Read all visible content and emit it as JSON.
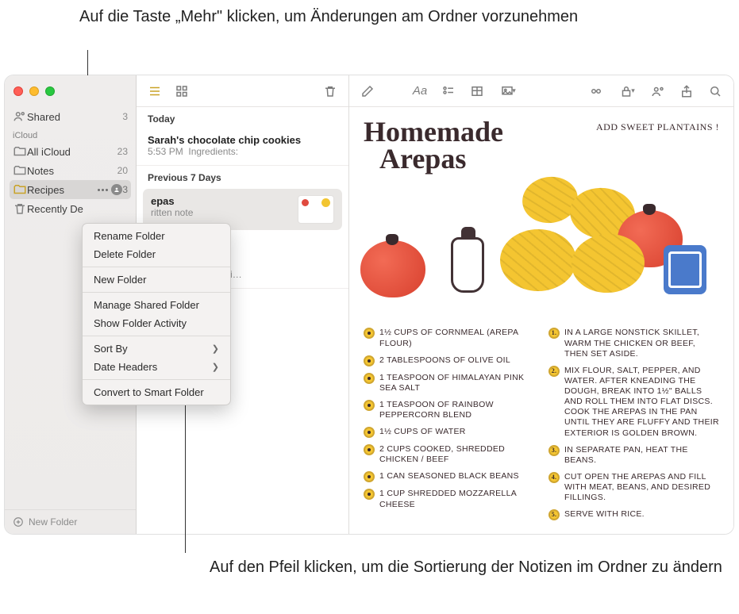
{
  "callouts": {
    "top": "Auf die Taste „Mehr\" klicken, um Änderungen am Ordner vorzunehmen",
    "bottom": "Auf den Pfeil klicken, um die Sortierung der Notizen im Ordner zu ändern"
  },
  "sidebar": {
    "shared": {
      "label": "Shared",
      "count": "3"
    },
    "section": "iCloud",
    "items": [
      {
        "label": "All iCloud",
        "count": "23"
      },
      {
        "label": "Notes",
        "count": "20"
      },
      {
        "label": "Recipes",
        "count": "3",
        "selected": true
      },
      {
        "label": "Recently De"
      }
    ],
    "footer": "New Folder"
  },
  "contextMenu": {
    "rename": "Rename Folder",
    "delete": "Delete Folder",
    "newFolder": "New Folder",
    "manageShared": "Manage Shared Folder",
    "showActivity": "Show Folder Activity",
    "sortBy": "Sort By",
    "dateHeaders": "Date Headers",
    "convert": "Convert to Smart Folder"
  },
  "noteList": {
    "section1": "Today",
    "item1": {
      "title": "Sarah's chocolate chip cookies",
      "time": "5:53 PM",
      "preview": "Ingredients:"
    },
    "section2": "Previous 7 Days",
    "item2": {
      "title": "epas",
      "sub": "ritten note"
    },
    "item3": {
      "sub": "cken piccata for a di…"
    }
  },
  "note": {
    "title1": "Homemade",
    "title2": "Arepas",
    "annotation": "ADD SWEET PLANTAINS !",
    "ingredients": [
      "1½ CUPS OF CORNMEAL (AREPA FLOUR)",
      "2 TABLESPOONS OF OLIVE OIL",
      "1 TEASPOON OF HIMALAYAN PINK SEA SALT",
      "1 TEASPOON OF RAINBOW PEPPERCORN BLEND",
      "1½ CUPS OF WATER",
      "2 CUPS COOKED, SHREDDED CHICKEN / BEEF",
      "1 CAN SEASONED BLACK BEANS",
      "1 CUP SHREDDED MOZZARELLA CHEESE"
    ],
    "steps": [
      "IN A LARGE NONSTICK SKILLET, WARM THE CHICKEN OR BEEF, THEN SET ASIDE.",
      "MIX FLOUR, SALT, PEPPER, AND WATER. AFTER KNEADING THE DOUGH, BREAK INTO 1½\" BALLS AND ROLL THEM INTO FLAT DISCS. COOK THE AREPAS IN THE PAN UNTIL THEY ARE FLUFFY AND THEIR EXTERIOR IS GOLDEN BROWN.",
      "IN SEPARATE PAN, HEAT THE BEANS.",
      "CUT OPEN THE AREPAS AND FILL WITH MEAT, BEANS, AND DESIRED FILLINGS.",
      "SERVE WITH RICE."
    ]
  }
}
